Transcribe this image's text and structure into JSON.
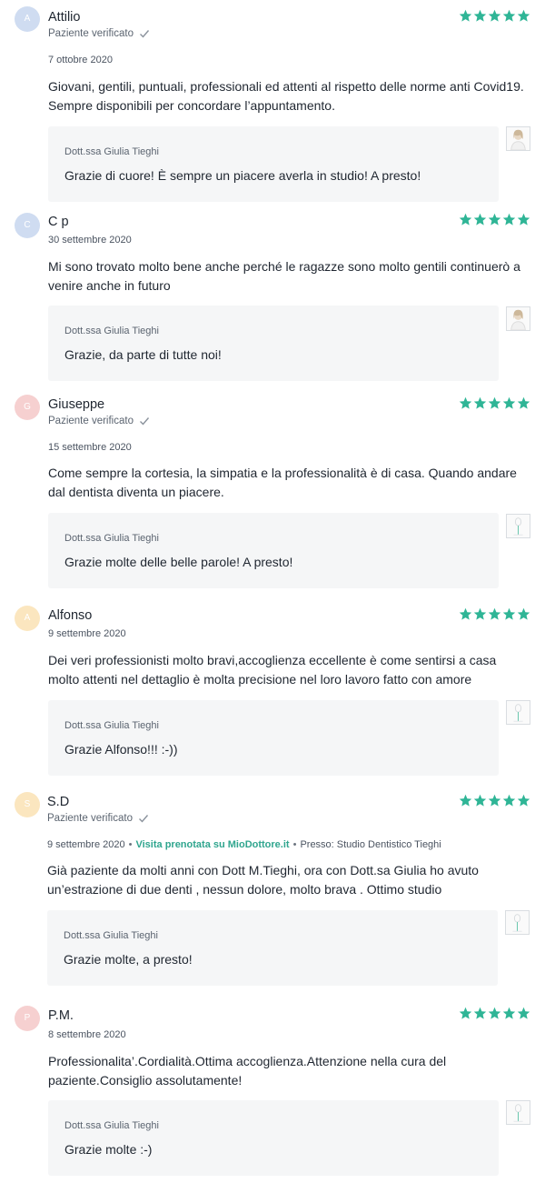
{
  "colors": {
    "star": "#2fb596",
    "accent": "#2fa58e"
  },
  "reviews": [
    {
      "initial": "A",
      "avatar_color": "#cfdcf1",
      "name": "Attilio",
      "verified": "Paziente verificato",
      "date": "7 ottobre 2020",
      "text_lines": [
        "Giovani, gentili, puntuali, professionali ed attenti al rispetto delle norme anti Covid19.",
        "Sempre disponibili per concordare l’appuntamento."
      ],
      "reply_author": "Dott.ssa Giulia Tieghi",
      "reply_text": "Grazie di cuore! È sempre un piacere averla in studio! A presto!"
    },
    {
      "initial": "C",
      "avatar_color": "#cfdcf1",
      "name": "C p",
      "date": "30 settembre 2020",
      "text_lines": [
        "Mi sono trovato molto bene anche perché le ragazze sono molto gentili continuerò a",
        "venire anche in futuro"
      ],
      "reply_author": "Dott.ssa Giulia Tieghi",
      "reply_text": "Grazie, da parte di tutte noi!"
    },
    {
      "initial": "G",
      "avatar_color": "#f6d0d0",
      "name": "Giuseppe",
      "verified": "Paziente verificato",
      "date": "15 settembre 2020",
      "text_lines": [
        "Come sempre la cortesia, la simpatia e la professionalità è di casa. Quando andare",
        "dal dentista diventa un piacere."
      ],
      "reply_author": "Dott.ssa Giulia Tieghi",
      "reply_text": "Grazie molte delle belle parole! A presto!"
    },
    {
      "initial": "A",
      "avatar_color": "#fbe6bf",
      "name": "Alfonso",
      "date": "9 settembre 2020",
      "text_lines": [
        "Dei veri professionisti molto bravi,accoglienza eccellente è come sentirsi a casa",
        "molto attenti nel dettaglio è molta precisione nel loro lavoro fatto con amore"
      ],
      "reply_author": "Dott.ssa Giulia Tieghi",
      "reply_text": "Grazie Alfonso!!! :-))"
    },
    {
      "initial": "S",
      "avatar_color": "#fbe6bf",
      "name": "S.D",
      "verified": "Paziente verificato",
      "date": "9 settembre 2020",
      "visit": "Visita prenotata su MioDottore.it",
      "place": "Presso: Studio Dentistico Tieghi",
      "text_lines": [
        "Già paziente da molti anni con Dott M.Tieghi, ora con Dott.sa Giulia ho avuto",
        "un’estrazione di due denti , nessun dolore, molto brava . Ottimo studio"
      ],
      "reply_author": "Dott.ssa Giulia Tieghi",
      "reply_text": "Grazie molte, a presto!"
    },
    {
      "initial": "P",
      "avatar_color": "#f6d0d0",
      "name": "P.M.",
      "date": "8 settembre 2020",
      "text_lines": [
        "Professionalita’.Cordialità.Ottima accoglienza.Attenzione nella cura del",
        "paziente.Consiglio assolutamente!"
      ],
      "reply_author": "Dott.ssa Giulia Tieghi",
      "reply_text": "Grazie molte :-)"
    }
  ]
}
